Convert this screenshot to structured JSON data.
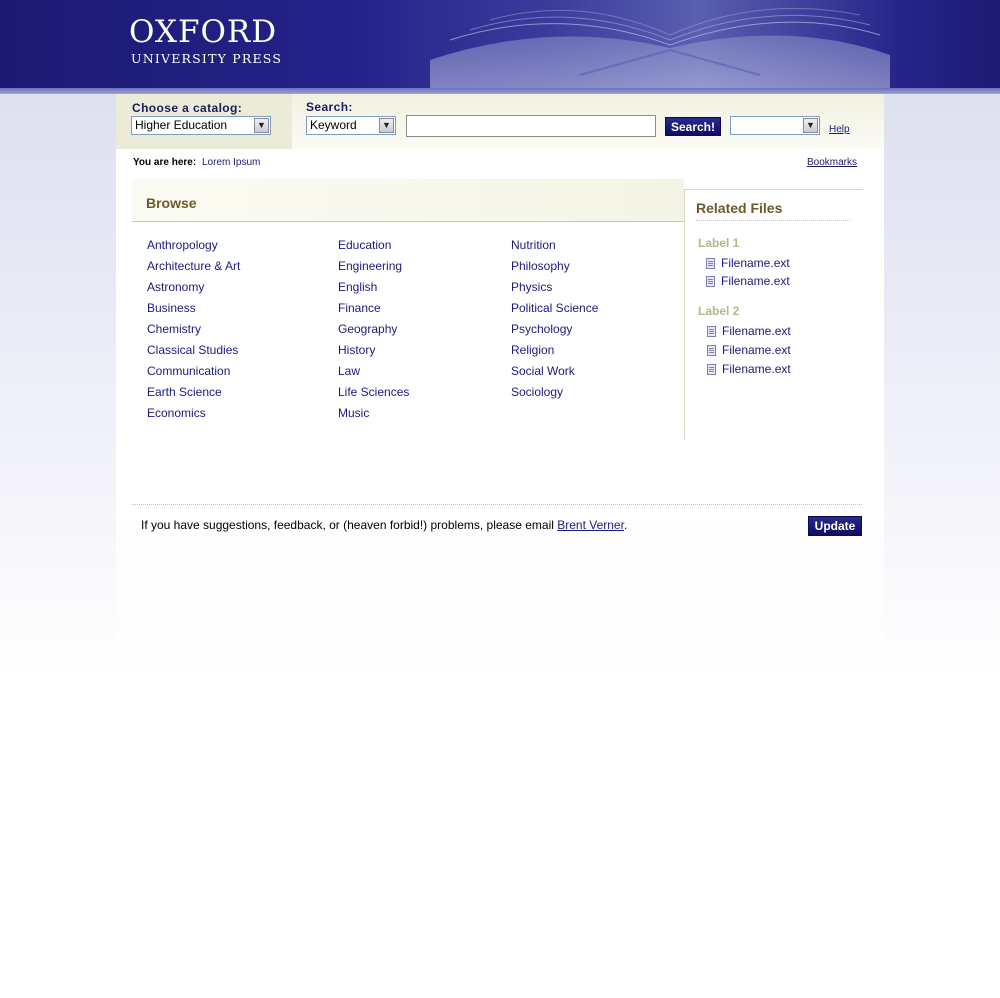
{
  "header": {
    "logo_title": "OXFORD",
    "logo_subtitle": "UNIVERSITY PRESS"
  },
  "toolbar": {
    "catalog_label": "Choose a catalog:",
    "catalog_value": "Higher Education",
    "search_label": "Search:",
    "search_type_value": "Keyword",
    "search_input_value": "",
    "search_button": "Search!",
    "extra_select_value": "",
    "help_link": "Help"
  },
  "breadcrumb": {
    "label": "You are here:",
    "current": "Lorem Ipsum",
    "bookmarks": "Bookmarks"
  },
  "browse": {
    "title": "Browse",
    "columns": [
      [
        "Anthropology",
        "Architecture & Art",
        "Astronomy",
        "Business",
        "Chemistry",
        "Classical Studies",
        "Communication",
        "Earth Science",
        "Economics"
      ],
      [
        "Education",
        "Engineering",
        "English",
        "Finance",
        "Geography",
        "History",
        "Law",
        "Life Sciences",
        "Music"
      ],
      [
        "Nutrition",
        "Philosophy",
        "Physics",
        "Political Science",
        "Psychology",
        "Religion",
        "Social Work",
        "Sociology"
      ]
    ]
  },
  "related": {
    "title": "Related Files",
    "groups": [
      {
        "label": "Label 1",
        "files": [
          "Filename.ext",
          "Filename.ext"
        ]
      },
      {
        "label": "Label 2",
        "files": [
          "Filename.ext",
          "Filename.ext",
          "Filename.ext"
        ]
      }
    ]
  },
  "footer": {
    "text_before": "If you have suggestions, feedback, or (heaven forbid!) problems, please email ",
    "email_link": "Brent Verner",
    "text_after": ".",
    "update_button": "Update"
  },
  "colors": {
    "brand_navy": "#1c1a72",
    "link_blue": "#1c1a7e",
    "heading_brown": "#6b5a2c",
    "label_olive": "#b8b78a"
  },
  "icons": {
    "select_arrow": "chevron-down-icon",
    "file": "document-icon"
  }
}
